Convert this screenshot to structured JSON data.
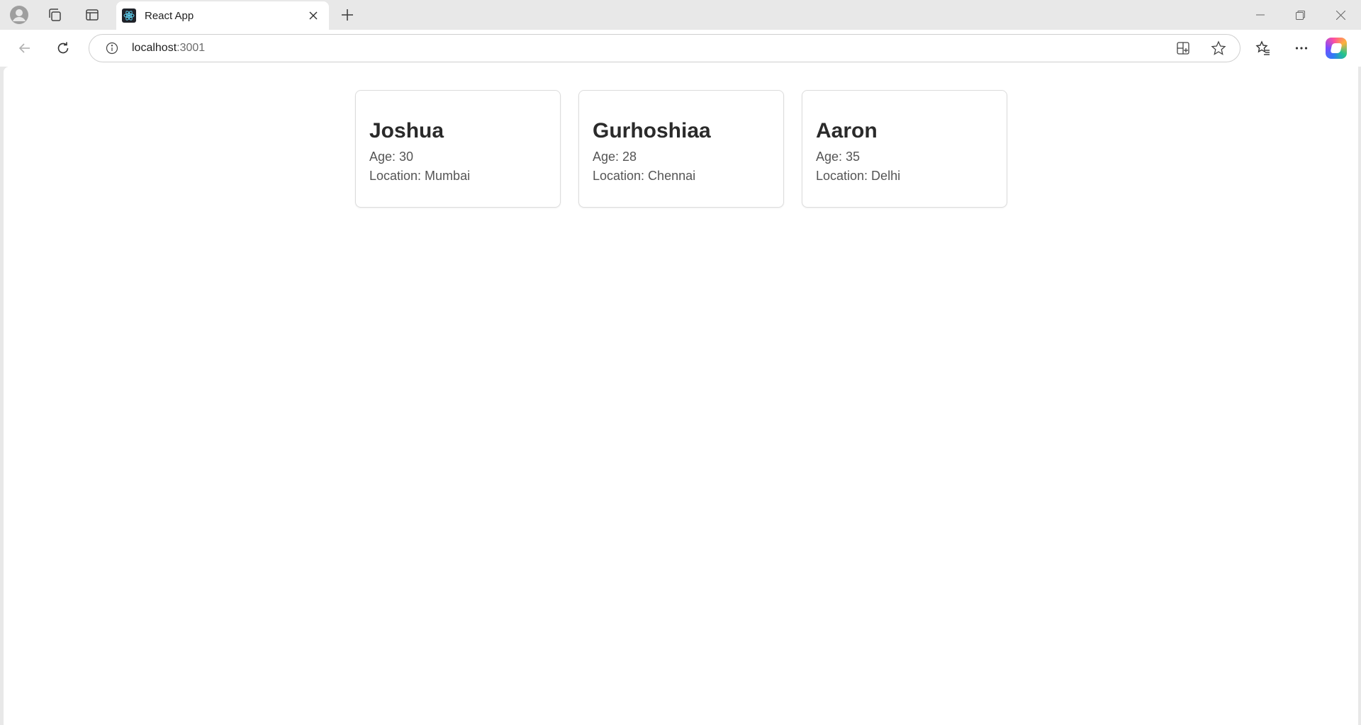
{
  "browser": {
    "tab": {
      "title": "React App",
      "favicon": "react-logo-icon"
    },
    "url": {
      "host": "localhost",
      "port": ":3001"
    },
    "icons": {
      "profile": "profile-icon",
      "workspaces": "workspaces-icon",
      "vertical_tabs": "vertical-tabs-icon",
      "close_tab": "close-icon",
      "new_tab": "plus-icon",
      "minimize": "minimize-icon",
      "restore": "restore-icon",
      "close_window": "close-window-icon",
      "back": "back-arrow-icon",
      "refresh": "refresh-icon",
      "site_info": "info-icon",
      "app_available": "app-available-icon",
      "favorite": "star-icon",
      "favorites": "favorites-icon",
      "more": "more-icon",
      "copilot": "copilot-icon"
    }
  },
  "people": [
    {
      "name": "Joshua",
      "age": "Age: 30",
      "location": "Location: Mumbai"
    },
    {
      "name": "Gurhoshiaa",
      "age": "Age: 28",
      "location": "Location: Chennai"
    },
    {
      "name": "Aaron",
      "age": "Age: 35",
      "location": "Location: Delhi"
    }
  ]
}
